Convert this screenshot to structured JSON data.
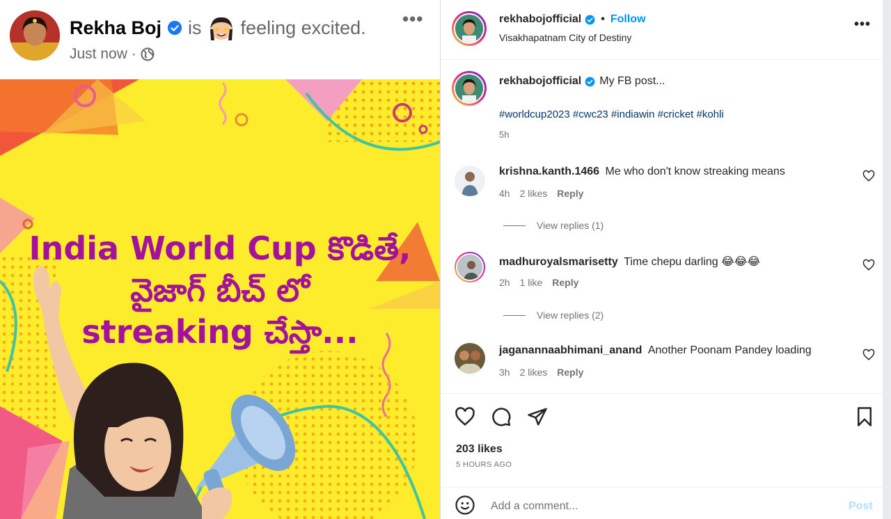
{
  "facebook": {
    "author": "Rekha Boj",
    "is_text": "is",
    "feeling": "feeling excited.",
    "timestamp": "Just now ·",
    "more_icon": "more-horizontal-icon",
    "image": {
      "headline_line1": "India World Cup కొడితే,",
      "headline_line2": "వైజాగ్ బీచ్ లో",
      "headline_line3": "streaking చేస్తా...",
      "colors": {
        "background": "#fcec2c",
        "headline": "#a3119d"
      }
    }
  },
  "instagram": {
    "header": {
      "username": "rekhabojofficial",
      "separator": "•",
      "follow_label": "Follow",
      "location": "Visakhapatnam City of Destiny"
    },
    "caption": {
      "username": "rekhabojofficial",
      "text": "My FB post...",
      "hashtags": "#worldcup2023 #cwc23 #indiawin #cricket #kohli",
      "time": "5h"
    },
    "comments": [
      {
        "username": "krishna.kanth.1466",
        "text": "Me who don't know streaking means",
        "time": "4h",
        "likes": "2 likes",
        "reply": "Reply",
        "view_replies": "View replies (1)"
      },
      {
        "username": "madhuroyalsmarisetty",
        "text": "Time chepu darling 😂😂😂",
        "time": "2h",
        "likes": "1 like",
        "reply": "Reply",
        "view_replies": "View replies (2)"
      },
      {
        "username": "jaganannaabhimani_anand",
        "text": "Another Poonam Pandey loading",
        "time": "3h",
        "likes": "2 likes",
        "reply": "Reply"
      }
    ],
    "likes_count": "203 likes",
    "posted_ago": "5 HOURS AGO",
    "comment_placeholder": "Add a comment...",
    "post_label": "Post",
    "colors": {
      "link": "#0095f6",
      "hashtag": "#00376b",
      "muted": "#737373"
    }
  }
}
